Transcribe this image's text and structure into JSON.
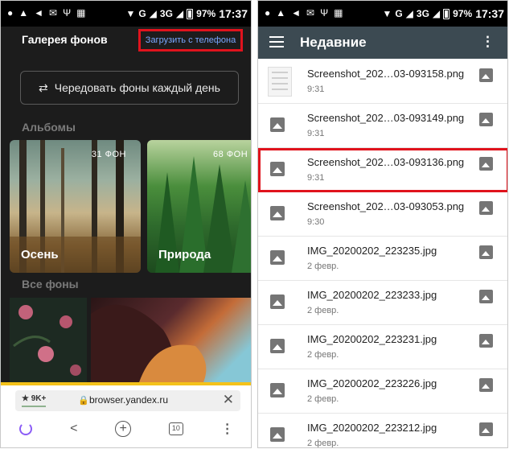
{
  "left_phone": {
    "status_bar": {
      "network": "G",
      "network2": "3G",
      "battery": "97%",
      "time": "17:37"
    },
    "gallery_title": "Галерея фонов",
    "upload_button": "Загрузить с телефона",
    "shuffle_button": "Чередовать фоны каждый день",
    "albums_heading": "Альбомы",
    "albums": [
      {
        "count": "31 ФОН",
        "name": "Осень"
      },
      {
        "count": "68 ФОН",
        "name": "Природа"
      }
    ],
    "all_backgrounds_heading": "Все фоны",
    "url_bar": {
      "rating": "★ 9K+",
      "url": "browser.yandex.ru",
      "close": "✕"
    },
    "nav": {
      "tabs_count": "10"
    }
  },
  "right_phone": {
    "status_bar": {
      "network": "G",
      "network2": "3G",
      "battery": "97%",
      "time": "17:37"
    },
    "title": "Недавние",
    "files": [
      {
        "name": "Screenshot_202…03-093158.png",
        "time": "9:31"
      },
      {
        "name": "Screenshot_202…03-093149.png",
        "time": "9:31"
      },
      {
        "name": "Screenshot_202…03-093136.png",
        "time": "9:31"
      },
      {
        "name": "Screenshot_202…03-093053.png",
        "time": "9:30"
      },
      {
        "name": "IMG_20200202_223235.jpg",
        "time": "2 февр."
      },
      {
        "name": "IMG_20200202_223233.jpg",
        "time": "2 февр."
      },
      {
        "name": "IMG_20200202_223231.jpg",
        "time": "2 февр."
      },
      {
        "name": "IMG_20200202_223226.jpg",
        "time": "2 февр."
      },
      {
        "name": "IMG_20200202_223212.jpg",
        "time": "2 февр."
      }
    ]
  },
  "colors": {
    "highlight": "#e0131d",
    "link": "#7aa7ff",
    "appbar": "#3c4a52",
    "alice": "#8b5cf6"
  }
}
